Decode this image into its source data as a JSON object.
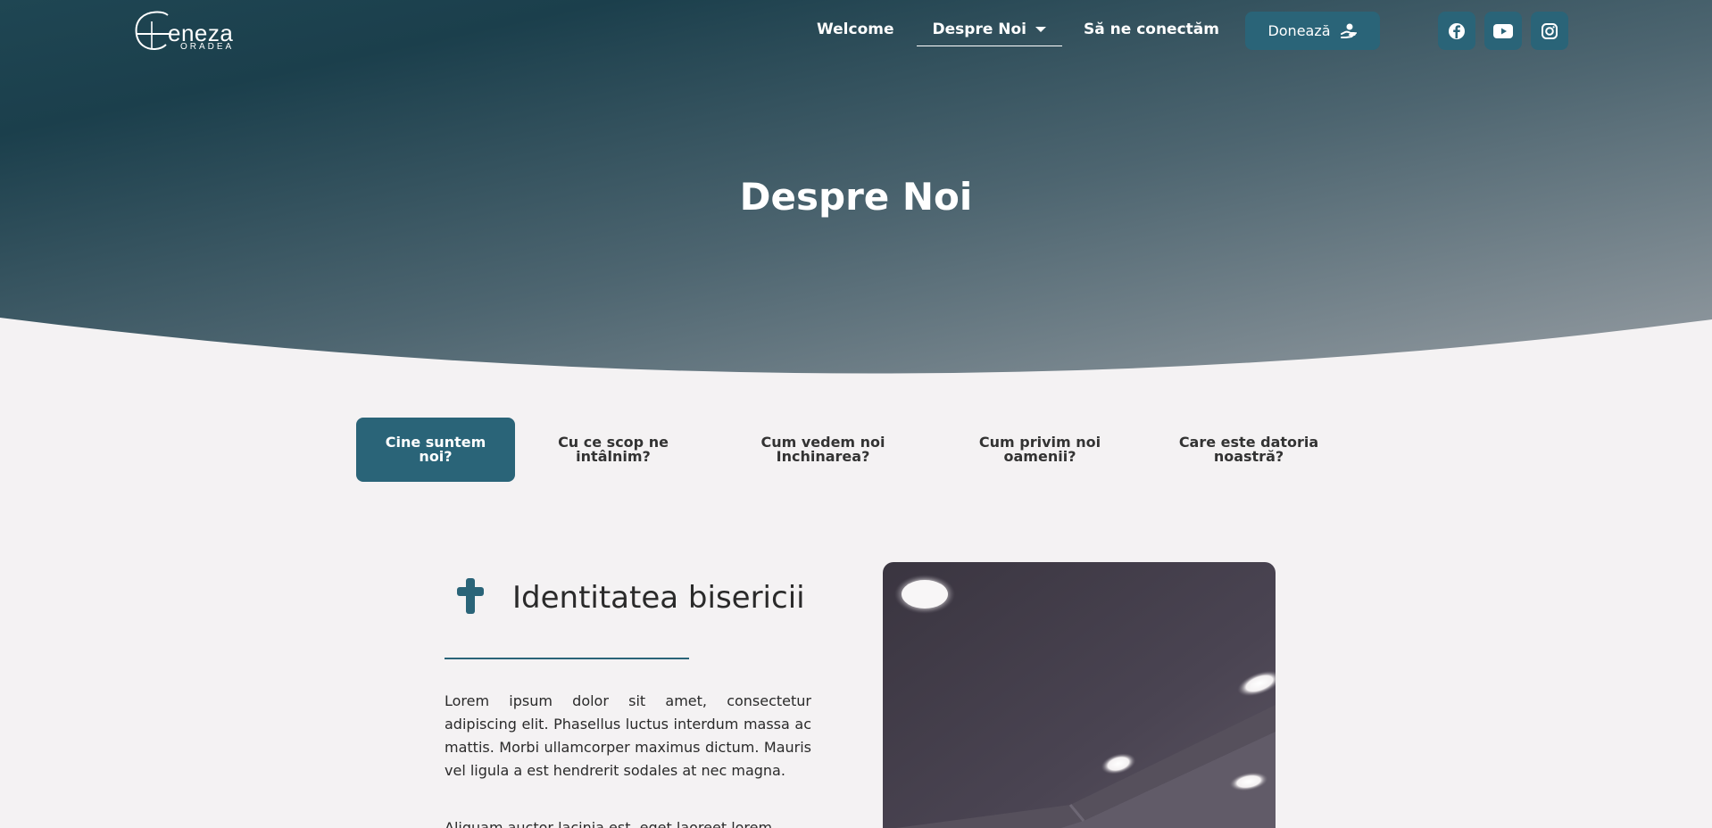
{
  "brand": {
    "logo_word": "eneza",
    "logo_sub": "ORADEA"
  },
  "nav": {
    "items": [
      {
        "label": "Welcome"
      },
      {
        "label": "Despre Noi"
      },
      {
        "label": "Să ne conectăm"
      }
    ],
    "active": "Despre Noi"
  },
  "donate": {
    "label": "Donează",
    "icon": "hand-heart-icon"
  },
  "social": [
    {
      "name": "facebook-icon"
    },
    {
      "name": "youtube-icon"
    },
    {
      "name": "instagram-icon"
    }
  ],
  "hero": {
    "title": "Despre Noi"
  },
  "tabs": [
    {
      "label": "Cine suntem noi?",
      "active": true
    },
    {
      "label": "Cu ce scop ne intâlnim?",
      "active": false
    },
    {
      "label": "Cum vedem noi Inchinarea?",
      "active": false
    },
    {
      "label": "Cum privim noi oamenii?",
      "active": false
    },
    {
      "label": "Care este datoria noastră?",
      "active": false
    }
  ],
  "section": {
    "icon": "cross-icon",
    "title": "Identitatea bisericii",
    "paragraphs": [
      "Lorem ipsum dolor sit amet, consectetur adipiscing elit. Phasellus luctus interdum massa ac mattis. Morbi ullamcorper maximus dictum. Mauris vel ligula a est hendrerit sodales at nec magna.",
      "Aliquam auctor lacinia est, eget laoreet lorem"
    ]
  },
  "colors": {
    "accent": "#2a6478",
    "hero_dark": "#1b3f4c",
    "hero_light": "#8b949b",
    "page_bg": "#f4f2f3"
  }
}
